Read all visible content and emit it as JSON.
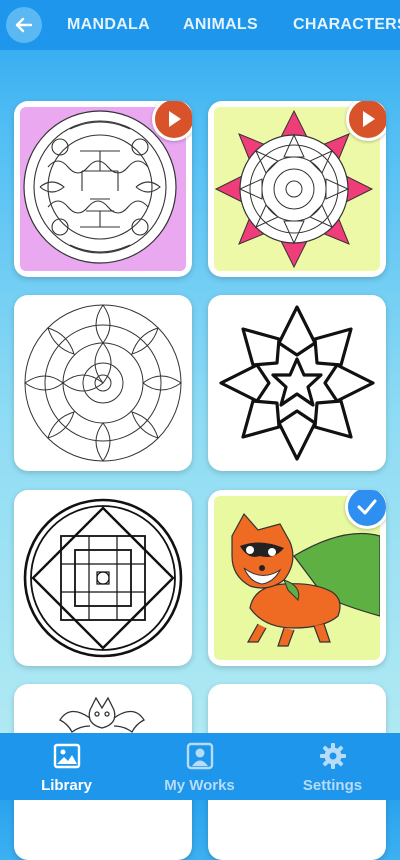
{
  "topbar": {
    "back_icon": "arrow-left-icon",
    "tabs": [
      {
        "label": "MANDALA"
      },
      {
        "label": "ANIMALS"
      },
      {
        "label": "CHARACTERS"
      }
    ]
  },
  "library": {
    "items": [
      {
        "name": "mandala-purple",
        "background": "#e9a8f0",
        "badge": "play-icon"
      },
      {
        "name": "mandala-pink-flower",
        "background": "#eef9a8",
        "badge": "play-icon"
      },
      {
        "name": "mandala-lace",
        "background": "#ffffff"
      },
      {
        "name": "mandala-bold-flower",
        "background": "#ffffff"
      },
      {
        "name": "mandala-geometric",
        "background": "#ffffff"
      },
      {
        "name": "fox-superhero",
        "background": "#e9f9a0",
        "badge": "check-icon"
      },
      {
        "name": "bat-character",
        "background": "#ffffff"
      },
      {
        "name": "blank-page",
        "background": "#ffffff"
      }
    ]
  },
  "bottom_nav": {
    "items": [
      {
        "label": "Library",
        "icon": "image-icon",
        "active": true
      },
      {
        "label": "My Works",
        "icon": "portrait-icon",
        "active": false
      },
      {
        "label": "Settings",
        "icon": "gear-icon",
        "active": false
      }
    ]
  },
  "colors": {
    "topbar": "#1e96ec",
    "play_badge": "#d9532a",
    "check_badge": "#2f8ff0",
    "active_nav": "#ffffff",
    "inactive_nav": "#b7dcf8"
  }
}
